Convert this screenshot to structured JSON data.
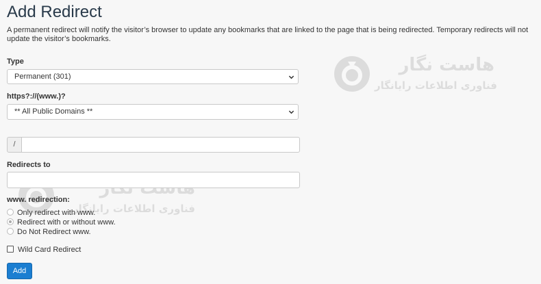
{
  "page": {
    "title": "Add Redirect",
    "description": "A permanent redirect will notify the visitor’s browser to update any bookmarks that are linked to the page that is being redirected. Temporary redirects will not update the visitor’s bookmarks."
  },
  "form": {
    "type_label": "Type",
    "type_value": "Permanent (301)",
    "domain_label": "https?://(www.)?",
    "domain_value": "** All Public Domains **",
    "path_prefix": "/",
    "path_value": "",
    "redirects_to_label": "Redirects to",
    "redirects_to_value": "",
    "www_label": "www. redirection:",
    "www_options": [
      {
        "label": "Only redirect with www.",
        "checked": false
      },
      {
        "label": "Redirect with or without www.",
        "checked": true
      },
      {
        "label": "Do Not Redirect www.",
        "checked": false
      }
    ],
    "wildcard_label": "Wild Card Redirect",
    "wildcard_checked": false,
    "add_button": "Add"
  },
  "watermark": {
    "brand": "هاست نگار",
    "tagline": "فناوری اطلاعات رایانگار",
    "logo_icon": "hostnegar-logo-icon"
  },
  "colors": {
    "title": "#293a4a",
    "primary_button": "#1b7ed1",
    "background": "#f7f7f7"
  }
}
